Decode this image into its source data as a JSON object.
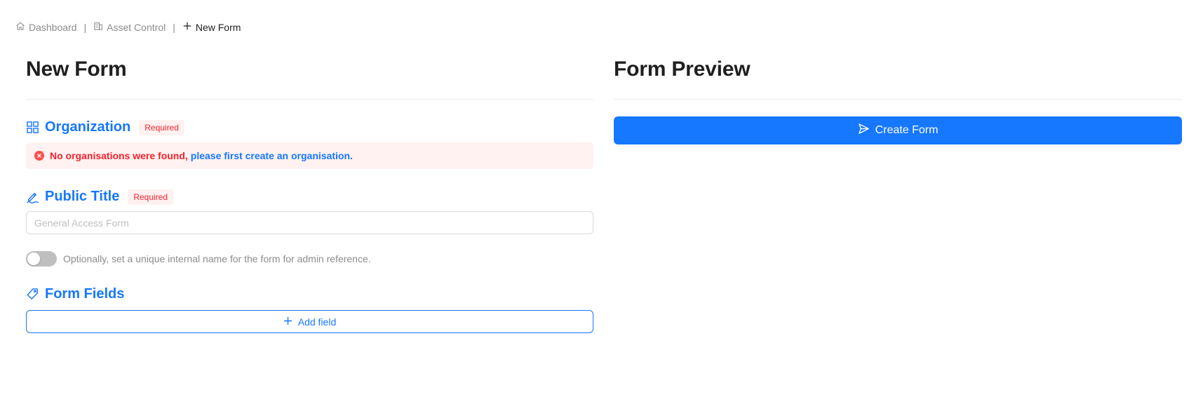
{
  "breadcrumb": {
    "items": [
      {
        "label": "Dashboard",
        "icon": "home-icon"
      },
      {
        "label": "Asset Control",
        "icon": "building-icon"
      },
      {
        "label": "New Form",
        "icon": "plus-icon"
      }
    ],
    "separator": "|"
  },
  "form": {
    "title": "New Form",
    "organization": {
      "title": "Organization",
      "icon": "grid-icon",
      "badge": "Required",
      "error_text": "No organisations were found,",
      "error_link": "please first create an organisation."
    },
    "public_title": {
      "title": "Public Title",
      "icon": "signature-icon",
      "badge": "Required",
      "placeholder": "General Access Form",
      "value": ""
    },
    "internal_name_toggle": {
      "checked": false,
      "label": "Optionally, set a unique internal name for the form for admin reference."
    },
    "form_fields": {
      "title": "Form Fields",
      "icon": "tag-icon",
      "add_label": "Add field"
    }
  },
  "preview": {
    "title": "Form Preview",
    "create_label": "Create Form",
    "create_icon": "send-icon"
  },
  "colors": {
    "accent": "#1677ff",
    "error": "#f5222d",
    "error_bg": "#fff2f0"
  }
}
